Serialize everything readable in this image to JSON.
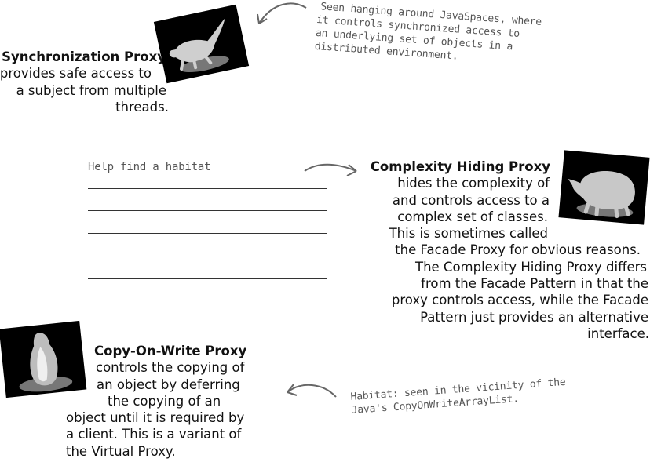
{
  "sync": {
    "title": "Synchronization Proxy",
    "lines": [
      "provides safe access to",
      "a subject from multiple",
      "threads."
    ],
    "note": [
      "Seen hanging around JavaSpaces, where",
      "it controls synchronized access to",
      "an underlying set of objects in a",
      "distributed environment."
    ],
    "image_icon": "lizard-photo-icon"
  },
  "habitat_form": {
    "label": "Help find a habitat"
  },
  "complexity": {
    "title": "Complexity Hiding Proxy",
    "lines": [
      "hides the complexity of",
      "and controls access to a",
      "complex set of classes.",
      "This is sometimes called",
      "the Facade Proxy for obvious reasons.",
      "The Complexity Hiding Proxy differs",
      "from the Facade Pattern in that the",
      "proxy controls access, while the Facade",
      "Pattern just provides an alternative",
      "interface."
    ],
    "image_icon": "rhino-photo-icon"
  },
  "cow": {
    "title": "Copy-On-Write Proxy",
    "lines": [
      "controls the copying of",
      "an object by deferring",
      "the copying of an",
      "object until it is required by",
      "a client. This is a variant of",
      "the Virtual Proxy."
    ],
    "note": [
      "Habitat: seen in the vicinity of the",
      "Java's CopyOnWriteArrayList."
    ],
    "image_icon": "penguin-photo-icon"
  }
}
